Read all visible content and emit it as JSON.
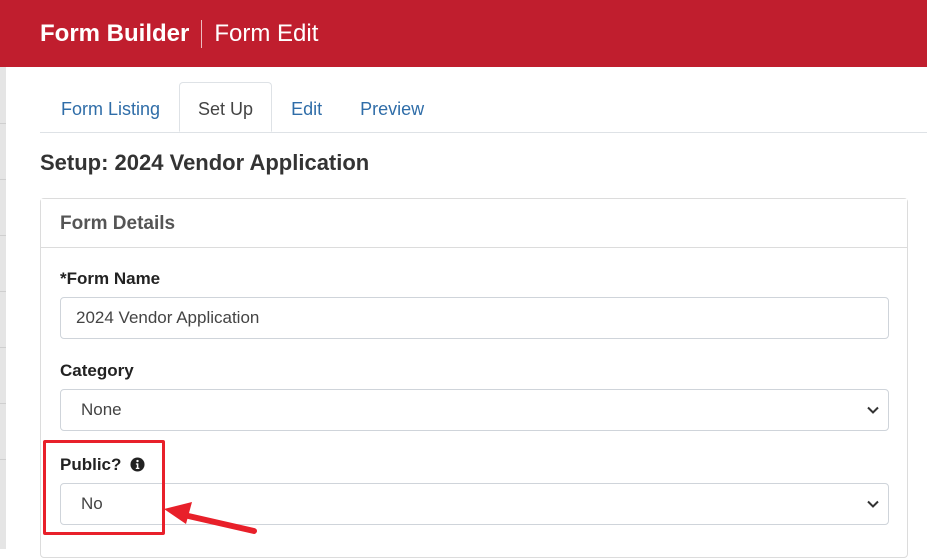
{
  "header": {
    "app_title": "Form Builder",
    "page_title": "Form Edit"
  },
  "tabs": [
    {
      "label": "Form Listing",
      "active": false
    },
    {
      "label": "Set Up",
      "active": true
    },
    {
      "label": "Edit",
      "active": false
    },
    {
      "label": "Preview",
      "active": false
    }
  ],
  "page": {
    "title": "Setup: 2024 Vendor Application"
  },
  "card": {
    "header": "Form Details",
    "fields": {
      "form_name": {
        "label": "*Form Name",
        "value": "2024 Vendor Application"
      },
      "category": {
        "label": "Category",
        "value": "None"
      },
      "public": {
        "label": "Public?",
        "value": "No"
      }
    }
  },
  "annotation": {
    "highlight_color": "#e8202a"
  },
  "colors": {
    "header_bg": "#c01e2e",
    "link": "#2f6da8"
  },
  "icons": {
    "info": "info-circle-icon",
    "select": "chevron-down-icon",
    "pointer": "red-arrow-icon"
  }
}
